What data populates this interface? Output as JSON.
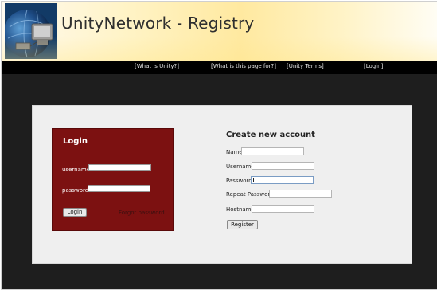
{
  "header": {
    "title": "UnityNetwork - Registry"
  },
  "nav": [
    {
      "label": "[What is Unity?]"
    },
    {
      "label": "[What is this page for?]"
    },
    {
      "label": "[Unity Terms]"
    },
    {
      "label": "[Login]"
    }
  ],
  "login": {
    "heading": "Login",
    "username_label": "username",
    "password_label": "password",
    "login_button": "Login",
    "forgot_link": "Forgot password"
  },
  "create": {
    "heading": "Create new account",
    "fields": [
      {
        "label": "Name",
        "value": ""
      },
      {
        "label": "Username",
        "value": ""
      },
      {
        "label": "Password",
        "value": ""
      },
      {
        "label": "Repeat Password",
        "value": ""
      },
      {
        "label": "Hostname",
        "value": ""
      }
    ],
    "register_button": "Register"
  },
  "colors": {
    "login_bg": "#7c1111",
    "nav_bg": "#000000",
    "page_bg": "#1e1e1e"
  }
}
